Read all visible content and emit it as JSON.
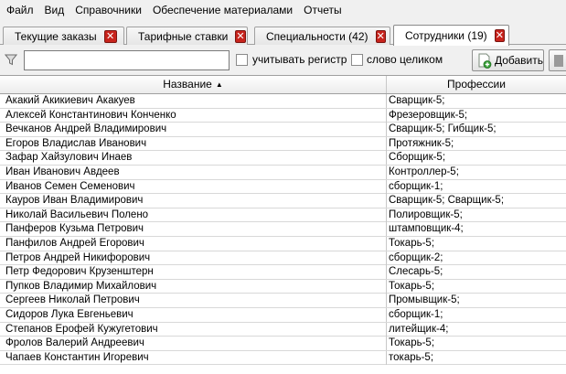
{
  "menu": [
    "Файл",
    "Вид",
    "Справочники",
    "Обеспечение материалами",
    "Отчеты"
  ],
  "tabs": [
    {
      "label": "Текущие заказы",
      "active": false
    },
    {
      "label": "Тарифные ставки",
      "active": false
    },
    {
      "label": "Специальности (42)",
      "active": false
    },
    {
      "label": "Сотрудники (19)",
      "active": true
    }
  ],
  "filter": {
    "search_value": "",
    "case_label": "учитывать регистр",
    "whole_word_label": "слово целиком",
    "add_label": "Добавить"
  },
  "table": {
    "columns": [
      "Название",
      "Профессии"
    ],
    "rows": [
      [
        "Акакий Акикиевич Акакуев",
        "Сварщик-5;"
      ],
      [
        "Алексей Константинович Конченко",
        "Фрезеровщик-5;"
      ],
      [
        "Вечканов Андрей Владимирович",
        "Сварщик-5; Гибщик-5;"
      ],
      [
        "Егоров Владислав Иванович",
        "Протяжник-5;"
      ],
      [
        "Зафар Хайзулович Инаев",
        "Сборщик-5;"
      ],
      [
        "Иван Иванович Авдеев",
        "Контроллер-5;"
      ],
      [
        "Иванов Семен Семенович",
        "сборщик-1;"
      ],
      [
        "Кауров Иван Владимирович",
        "Сварщик-5; Сварщик-5;"
      ],
      [
        "Николай Васильевич Полено",
        "Полировщик-5;"
      ],
      [
        "Панферов Кузьма Петрович",
        "штамповщик-4;"
      ],
      [
        "Панфилов Андрей Егорович",
        "Токарь-5;"
      ],
      [
        "Петров Андрей Никифорович",
        "сборщик-2;"
      ],
      [
        "Петр Федорович Крузенштерн",
        "Слесарь-5;"
      ],
      [
        "Пупков Владимир Михайлович",
        "Токарь-5;"
      ],
      [
        "Сергеев Николай Петрович",
        "Промывщик-5;"
      ],
      [
        "Сидоров Лука Евгеньевич",
        "сборщик-1;"
      ],
      [
        "Степанов Ерофей Кужугетович",
        "литейщик-4;"
      ],
      [
        "Фролов Валерий Андреевич",
        "Токарь-5;"
      ],
      [
        "Чапаев Константин Игоревич",
        "токарь-5;"
      ]
    ]
  }
}
